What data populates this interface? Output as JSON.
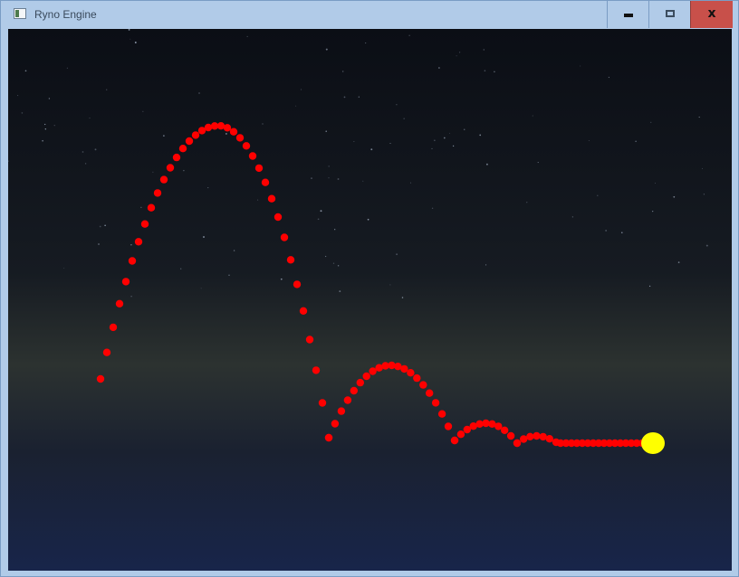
{
  "window": {
    "title": "Ryno Engine",
    "controls": {
      "minimize_icon": "minimize-icon",
      "maximize_icon": "maximize-icon",
      "close_label": "x"
    }
  },
  "scene": {
    "colors": {
      "sky_top": "#0b0e15",
      "sky_mid": "#161b22",
      "horizon_glow": "#2c3230",
      "sea_top": "#1a2130",
      "sea_bottom": "#18254a",
      "trail": "#ff0000",
      "ball": "#ffff00"
    }
  }
}
